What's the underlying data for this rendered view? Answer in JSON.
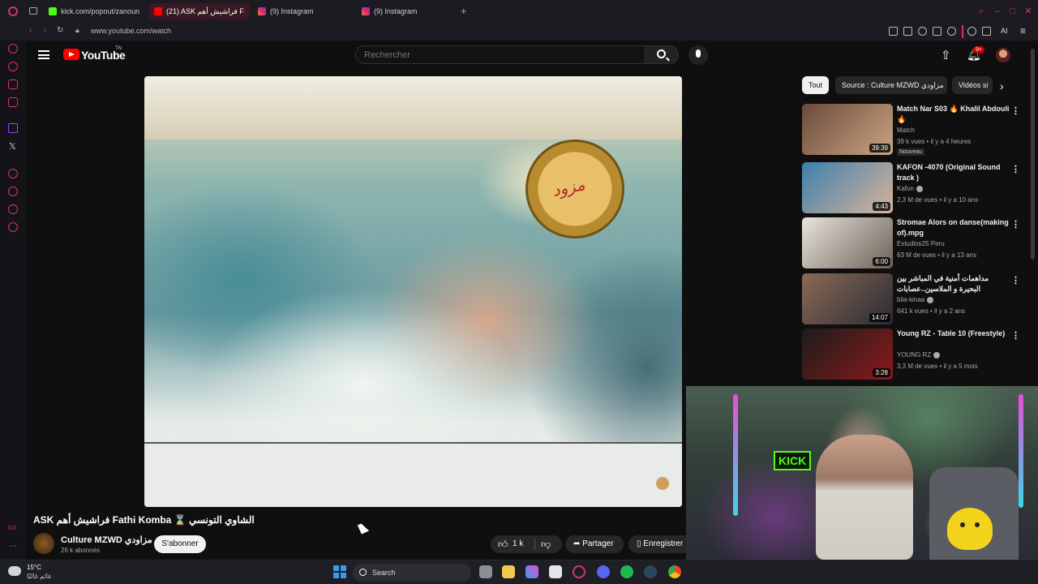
{
  "browser": {
    "tabs": [
      {
        "label": "kick.com/popout/zanoun",
        "active": false,
        "favicon": "kick-icon",
        "color": "#53fc18"
      },
      {
        "label": "(21) ASK فراشيش أهم F",
        "active": true,
        "favicon": "youtube-icon",
        "color": "#ff0000"
      },
      {
        "label": "(9) Instagram",
        "active": false,
        "favicon": "instagram-icon",
        "color": "#e1306c"
      },
      {
        "label": "(9) Instagram",
        "active": false,
        "favicon": "instagram-icon",
        "color": "#e1306c"
      }
    ],
    "new_tab": "+",
    "url": "www.youtube.com/watch",
    "ai_label": "AI"
  },
  "youtube": {
    "logo_text": "YouTube",
    "logo_region": "TN",
    "search_placeholder": "Rechercher",
    "notification_count": "9+",
    "chips": [
      {
        "label": "Tout",
        "selected": true
      },
      {
        "label": "Source : Culture MZWD مزاودي",
        "selected": false
      },
      {
        "label": "Vidéos si",
        "selected": false
      }
    ],
    "video": {
      "title": "ASK فراشيش أهم Fathi Komba ⌛ الشاوي التونسي",
      "logo_text": "مزود",
      "channel": "Culture MZWD مزاودي",
      "subscribers": "26 k abonnés",
      "subscribe_label": "S'abonner",
      "likes": "1 k",
      "share_label": "Partager",
      "save_label": "Enregistrer"
    },
    "recommended": [
      {
        "title": "Match Nar S03 🔥 Khalil Abdouli 🔥",
        "channel": "Match",
        "verified": false,
        "meta": "39 k vues • il y a 4 heures",
        "badge": "Nouveau",
        "duration": "39:39",
        "colors": [
          "#6b4a3a",
          "#c9a583"
        ]
      },
      {
        "title": "KAFON -4070 (Original Sound track )",
        "channel": "Kafon",
        "verified": true,
        "meta": "2,3 M de vues • il y a 10 ans",
        "badge": "",
        "duration": "4:43",
        "colors": [
          "#3d7fae",
          "#d8b49a"
        ]
      },
      {
        "title": "Stromae   Alors on danse(making of).mpg",
        "channel": "Estudios25 Peru",
        "verified": false,
        "meta": "63 M de vues • il y a 13 ans",
        "badge": "",
        "duration": "6:00",
        "colors": [
          "#e8e4dc",
          "#6e6258"
        ]
      },
      {
        "title": "مداهمات أمنية في المباشر بين البحيرة و الملاسين..عصابات البراكاجات ...",
        "channel": "bila-kinaa",
        "verified": true,
        "meta": "641 k vues • il y a 2 ans",
        "badge": "",
        "duration": "14:07",
        "colors": [
          "#8a6a55",
          "#2b2b33"
        ]
      },
      {
        "title": "Young RZ - Table 10 (Freestyle)",
        "channel": "YOUNG RZ",
        "verified": true,
        "meta": "3,3 M de vues • il y a 5 mois",
        "badge": "",
        "duration": "3:28",
        "colors": [
          "#1c1c1c",
          "#8a1a1a"
        ]
      }
    ]
  },
  "webcam": {
    "sign_text": "KICK"
  },
  "taskbar": {
    "temperature": "15°C",
    "weather_condition": "غائم غالبًا",
    "search_label": "Search"
  }
}
